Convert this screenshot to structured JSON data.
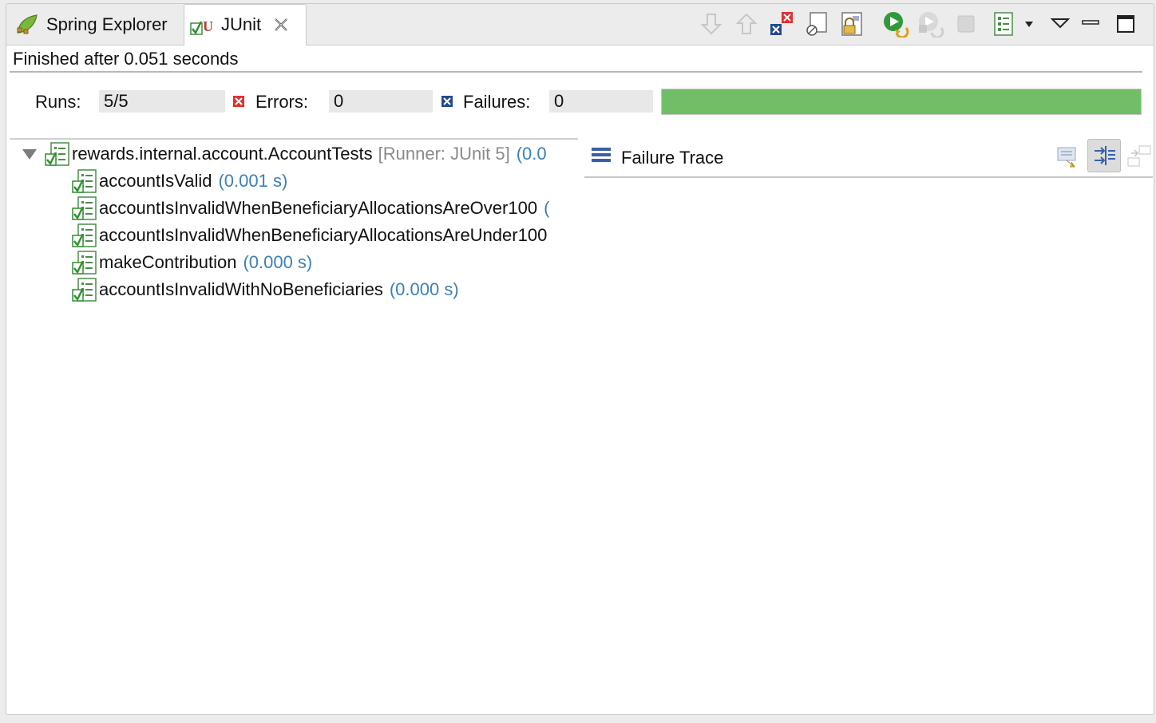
{
  "tabs": [
    {
      "label": "Spring Explorer"
    },
    {
      "label": "JUnit"
    }
  ],
  "status": {
    "finished": "Finished after 0.051 seconds"
  },
  "counters": {
    "runs_label": "Runs:",
    "runs_value": "5/5",
    "errors_label": "Errors:",
    "errors_value": "0",
    "failures_label": "Failures:",
    "failures_value": "0",
    "progress": 1.0,
    "progress_color": "#70bf66"
  },
  "tree": {
    "root": {
      "label": "rewards.internal.account.AccountTests",
      "runner": "[Runner: JUnit 5]",
      "time": "(0.0"
    },
    "children": [
      {
        "label": "accountIsValid",
        "time": "(0.001 s)"
      },
      {
        "label": "accountIsInvalidWhenBeneficiaryAllocationsAreOver100",
        "time": "("
      },
      {
        "label": "accountIsInvalidWhenBeneficiaryAllocationsAreUnder100",
        "time": ""
      },
      {
        "label": "makeContribution",
        "time": "(0.000 s)"
      },
      {
        "label": "accountIsInvalidWithNoBeneficiaries",
        "time": "(0.000 s)"
      }
    ]
  },
  "failure_trace": {
    "label": "Failure Trace"
  },
  "toolbar_icons": [
    "next-failure-icon",
    "previous-failure-icon",
    "show-failures-only-icon",
    "show-skipped-only-icon",
    "scroll-lock-icon",
    "rerun-test-icon",
    "rerun-failures-first-icon",
    "stop-icon",
    "test-run-history-icon",
    "view-menu-icon",
    "minimize-icon",
    "maximize-icon"
  ],
  "colors": {
    "time_text": "#3d7fb5",
    "runner_text": "#8a8a8a",
    "success_green": "#70bf66"
  }
}
